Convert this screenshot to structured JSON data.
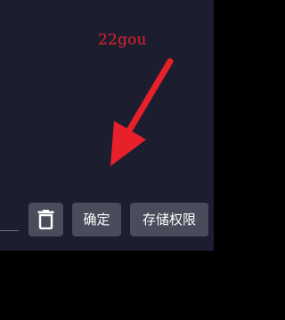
{
  "watermark": "22gou",
  "actions": {
    "delete_icon": "trash-icon",
    "confirm_label": "确定",
    "storage_permission_label": "存储权限"
  },
  "colors": {
    "dialog_background": "#1c1e30",
    "button_background": "#4a4c5c",
    "annotation_red": "#e8202a"
  }
}
